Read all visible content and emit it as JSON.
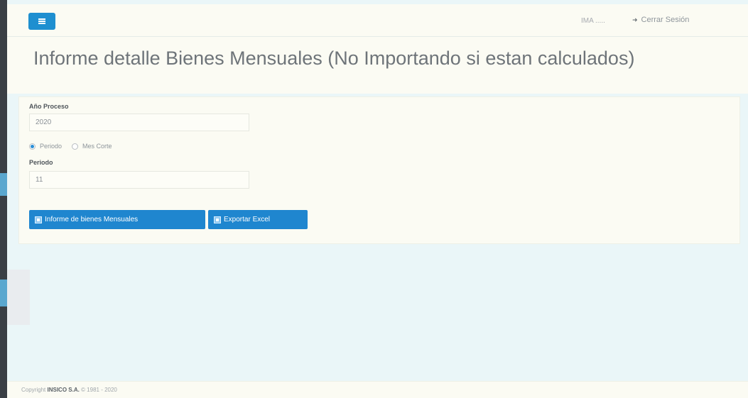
{
  "topbar": {
    "user_label": "IMA .....",
    "logout_label": "Cerrar Sesión"
  },
  "header": {
    "title": "Informe detalle Bienes Mensuales (No Importando si estan calculados)"
  },
  "form": {
    "year_label": "Año Proceso",
    "year_value": "2020",
    "radio_options": [
      {
        "label": "Periodo",
        "checked": true
      },
      {
        "label": "Mes Corte",
        "checked": false
      }
    ],
    "period_label": "Periodo",
    "period_value": "11"
  },
  "buttons": {
    "report_label": "Informe de bienes Mensuales",
    "export_label": "Exportar Excel"
  },
  "footer": {
    "copyright_prefix": "Copyright",
    "company": "INSICO S.A.",
    "years": "© 1981 - 2020"
  },
  "colors": {
    "primary": "#1f86cf",
    "panel_bg": "#fbfbf3",
    "page_bg": "#eaf6f8"
  }
}
